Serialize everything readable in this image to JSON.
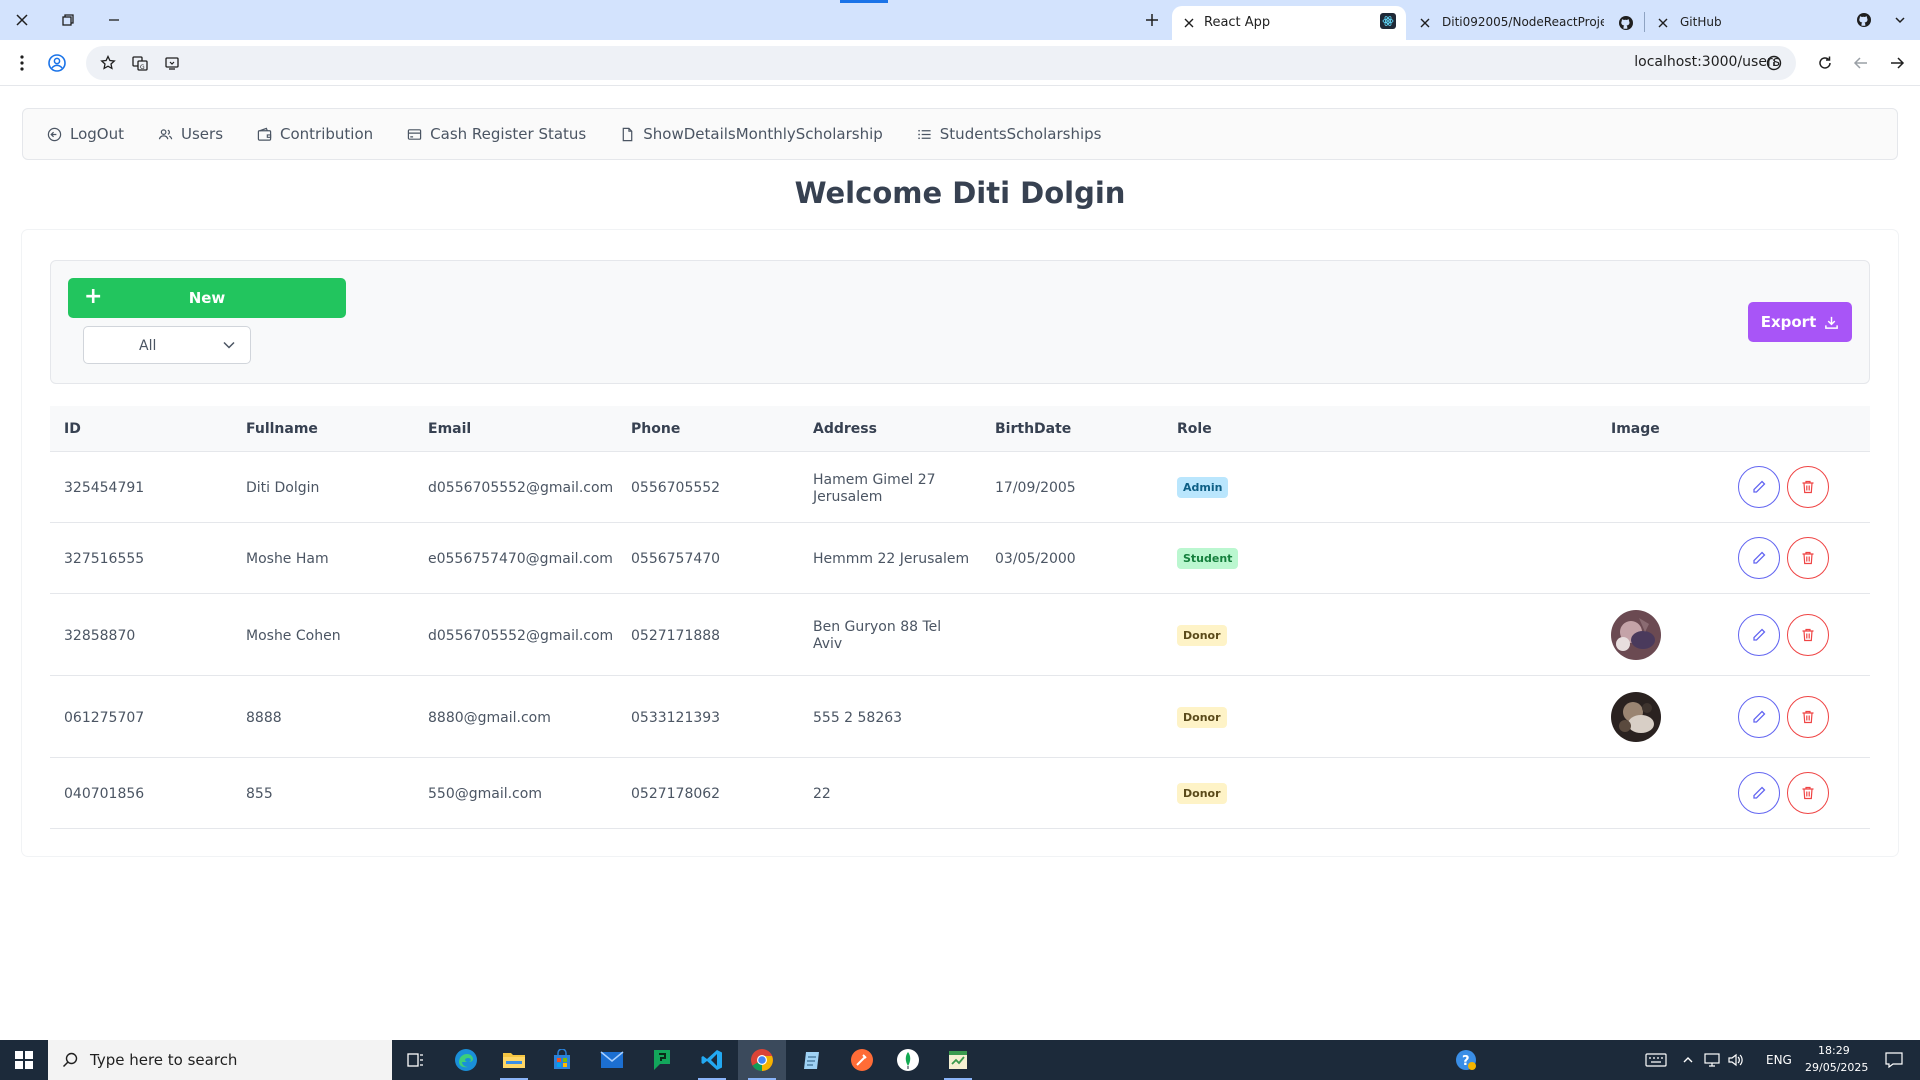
{
  "browser": {
    "active_tab_title": "React App",
    "tab2_title": "Diti092005/NodeReactProjectIn",
    "tab3_title": "GitHub",
    "url": "localhost:3000/users"
  },
  "nav": {
    "items": [
      {
        "label": "LogOut",
        "icon": "logout-icon"
      },
      {
        "label": "Users",
        "icon": "users-icon"
      },
      {
        "label": "Contribution",
        "icon": "wallet-icon"
      },
      {
        "label": "Cash Register Status",
        "icon": "credit-card-icon"
      },
      {
        "label": "ShowDetailsMonthlyScholarship",
        "icon": "file-icon"
      },
      {
        "label": "StudentsScholarships",
        "icon": "list-icon"
      }
    ]
  },
  "page": {
    "welcome": "Welcome Diti Dolgin"
  },
  "toolbar": {
    "new_label": "New",
    "filter_value": "All",
    "export_label": "Export"
  },
  "table": {
    "headers": {
      "id": "ID",
      "fullname": "Fullname",
      "email": "Email",
      "phone": "Phone",
      "address": "Address",
      "birthdate": "BirthDate",
      "role": "Role",
      "image": "Image"
    },
    "rows": [
      {
        "id": "325454791",
        "fullname": "Diti Dolgin",
        "email": "d0556705552@gmail.com",
        "phone": "0556705552",
        "address_l1": "Hamem Gimel 27",
        "address_l2": "Jerusalem",
        "birthdate": "17/09/2005",
        "role": "Admin",
        "has_image": false
      },
      {
        "id": "327516555",
        "fullname": "Moshe Ham",
        "email": "e0556757470@gmail.com",
        "phone": "0556757470",
        "address_l1": "Hemmm 22 Jerusalem",
        "address_l2": "",
        "birthdate": "03/05/2000",
        "role": "Student",
        "has_image": false
      },
      {
        "id": "32858870",
        "fullname": "Moshe Cohen",
        "email": "d0556705552@gmail.com",
        "phone": "0527171888",
        "address_l1": "Ben Guryon 88 Tel",
        "address_l2": "Aviv",
        "birthdate": "",
        "role": "Donor",
        "has_image": true
      },
      {
        "id": "061275707",
        "fullname": "8888",
        "email": "8880@gmail.com",
        "phone": "0533121393",
        "address_l1": "555 2 58263",
        "address_l2": "",
        "birthdate": "",
        "role": "Donor",
        "has_image": true
      },
      {
        "id": "040701856",
        "fullname": "855",
        "email": "550@gmail.com",
        "phone": "0527178062",
        "address_l1": "22",
        "address_l2": "",
        "birthdate": "",
        "role": "Donor",
        "has_image": false
      }
    ]
  },
  "taskbar": {
    "search_placeholder": "Type here to search",
    "lang": "ENG",
    "time": "18:29",
    "date": "29/05/2025"
  },
  "colors": {
    "new_button": "#22c55e",
    "export_button": "#a855f7",
    "edit_accent": "#6366f1",
    "delete_accent": "#ef4444"
  }
}
